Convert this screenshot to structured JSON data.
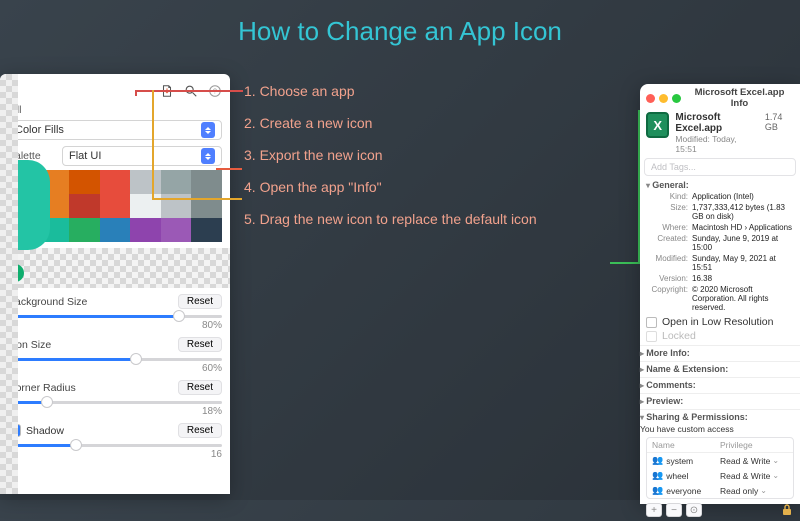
{
  "title": "How to Change an App Icon",
  "steps": [
    "1. Choose an app",
    "2. Create a new icon",
    "3. Export the new icon",
    "4. Open the app \"Info\"",
    "5. Drag the new icon to replace the default icon"
  ],
  "editor": {
    "fill_label": "Fill",
    "fill_value": "Color Fills",
    "palette_label": "Palette",
    "palette_value": "Flat UI",
    "swatches": [
      "#f39c12",
      "#e67e22",
      "#d35400",
      "#e74c3c",
      "#bdc3c7",
      "#95a5a6",
      "#7f8c8d",
      "#f1c40f",
      "#e67e22",
      "#c0392b",
      "#e74c3c",
      "#ecf0f1",
      "#bdc3c7",
      "#7f8c8d",
      "#16a085",
      "#1abc9c",
      "#27ae60",
      "#2980b9",
      "#8e44ad",
      "#9b59b6",
      "#2c3e50"
    ],
    "sliders": [
      {
        "label": "Background Size",
        "value": "80%",
        "pct": 80,
        "reset": "Reset"
      },
      {
        "label": "Icon Size",
        "value": "60%",
        "pct": 60,
        "reset": "Reset"
      },
      {
        "label": "Corner Radius",
        "value": "18%",
        "pct": 18,
        "reset": "Reset"
      }
    ],
    "shadow_label": "Shadow",
    "shadow_reset": "Reset",
    "shadow_value": "16"
  },
  "info": {
    "window_title": "Microsoft Excel.app Info",
    "app_name": "Microsoft Excel.app",
    "app_size": "1.74 GB",
    "modified_short": "Modified: Today, 15:51",
    "tags_placeholder": "Add Tags...",
    "general_label": "General:",
    "general": {
      "kind_k": "Kind:",
      "kind_v": "Application (Intel)",
      "size_k": "Size:",
      "size_v": "1,737,333,412 bytes (1.83 GB on disk)",
      "where_k": "Where:",
      "where_v": "Macintosh HD › Applications",
      "created_k": "Created:",
      "created_v": "Sunday, June 9, 2019 at 15:00",
      "modified_k": "Modified:",
      "modified_v": "Sunday, May 9, 2021 at 15:51",
      "version_k": "Version:",
      "version_v": "16.38",
      "copyright_k": "Copyright:",
      "copyright_v": "© 2020 Microsoft Corporation. All rights reserved."
    },
    "open_low_res": "Open in Low Resolution",
    "locked": "Locked",
    "sections": [
      "More Info:",
      "Name & Extension:",
      "Comments:",
      "Preview:",
      "Sharing & Permissions:"
    ],
    "perm_note": "You have custom access",
    "perm_header_name": "Name",
    "perm_header_priv": "Privilege",
    "perms": [
      {
        "user": "system",
        "priv": "Read & Write"
      },
      {
        "user": "wheel",
        "priv": "Read & Write"
      },
      {
        "user": "everyone",
        "priv": "Read only"
      }
    ]
  }
}
